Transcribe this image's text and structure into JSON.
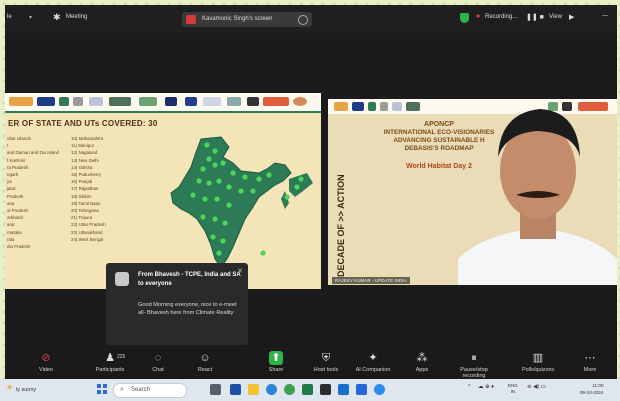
{
  "topbar": {
    "left_label": "le",
    "meeting_label": "Meeting",
    "share_label": "Kavamonic Singh's screen",
    "recording_label": "Recording...",
    "view_label": "View"
  },
  "slide": {
    "title": "ER OF STATE AND UTs COVERED: 30",
    "left_col": [
      "obar Islands",
      "",
      "t",
      "and Daman and Diu Island",
      "f Kashmir",
      "ra Pradesh",
      "",
      "ngarh",
      "ya",
      "jarat",
      "Pradesh",
      "ana",
      "al Pradesh",
      "arkhand",
      "arat",
      "rnataka",
      "rala",
      "dia Pradesh"
    ],
    "right_col": [
      "10) Maharashtra",
      "11) Manipur",
      "12) Nagaland",
      "13) New Delhi",
      "14) Odisha",
      "15) Puducherry",
      "16) Punjab",
      "17) Rajasthan",
      "18) Sikkim",
      "19) Tamil Nadu",
      "20) Telangana",
      "21) Tripura",
      "22) Uttar Pradesh",
      "23) Uttarakhand",
      "24) West Bengal"
    ]
  },
  "speaker_slide": {
    "org": "APONCP",
    "lines": [
      "INTERNATIONAL ECO-VISIONARIES",
      "ADVANCING SUSTAINABLE H",
      "DEBASIS'S ROADMAP"
    ],
    "event": "World Habitat Day 2",
    "decade": "DECADE OF >> ACTION",
    "name_tag": "RAJEEV KUMAR - UPDATE INDIA"
  },
  "notification": {
    "title": "From Bhavesh - TCPE, India and SA to everyone",
    "message": "Good Morning everyone, nice to e-meet all- Bhavesh here from Climate Reality"
  },
  "toolbar": {
    "items": [
      {
        "label": "Video",
        "icon": "video-off-icon"
      },
      {
        "label": "Participants",
        "count": "225",
        "icon": "participants-icon"
      },
      {
        "label": "Chat",
        "icon": "chat-icon"
      },
      {
        "label": "React",
        "icon": "react-icon"
      },
      {
        "label": "Share",
        "icon": "share-icon"
      },
      {
        "label": "Host tools",
        "icon": "host-tools-icon"
      },
      {
        "label": "AI Companion",
        "icon": "ai-companion-icon"
      },
      {
        "label": "Apps",
        "icon": "apps-icon"
      },
      {
        "label": "Pause/stop recording",
        "icon": "recording-icon"
      },
      {
        "label": "Polls/quizzes",
        "icon": "polls-icon"
      },
      {
        "label": "More",
        "icon": "more-icon"
      }
    ]
  },
  "taskbar": {
    "search_label": "Search",
    "weather": "ly sunny",
    "lang": "ENG",
    "lang_sub": "IN",
    "time": "11:00",
    "date": "09-10-2024"
  },
  "colors": {
    "map_green": "#2d7a57",
    "dot_green": "#49d65a",
    "accent_green": "#2db34a",
    "record_red": "#d63a3a"
  }
}
